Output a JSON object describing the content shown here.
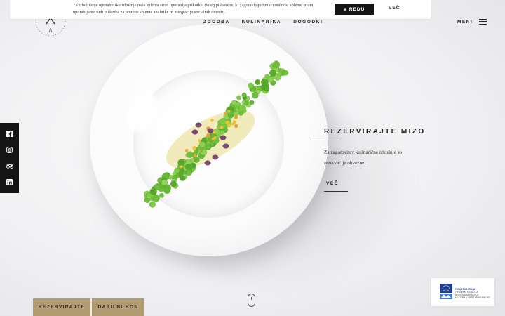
{
  "cookie": {
    "text": "Za izboljšanje uporabniške izkušnje naša spletna stran uporablja piškotke. Poleg piškotkov, ki zagotavljajo funkcionalnost spletne strani, uporabljamo tudi piškotke za potrebe spletne analitike in integracijo socialnih omrežij.",
    "accept_label": "V REDU",
    "more_label": "VEČ"
  },
  "logo": {
    "name": "logo-icon"
  },
  "nav": {
    "items": [
      {
        "label": "ZGODBA"
      },
      {
        "label": "KULINARIKA"
      },
      {
        "label": "DOGODKI"
      }
    ],
    "menu_label": "MENI"
  },
  "social": {
    "icons": [
      "facebook-icon",
      "instagram-icon",
      "tripadvisor-icon",
      "linkedin-icon"
    ]
  },
  "reservation": {
    "title": "REZERVIRAJTE MIZO",
    "text": "Za zagotovitev kulinarične izkušnje so rezervacije obvezne.",
    "more_label": "VEČ"
  },
  "bottom": {
    "reserve_label": "REZERVIRAJTE",
    "voucher_label": "DARILNI BON"
  },
  "eu_badge": {
    "title": "EVROPSKA UNIJA",
    "line1": "EVROPSKI SKLAD ZA",
    "line2": "REGIONALNI RAZVOJ",
    "line3": "NALOŽBA V VAŠO PRIHODNOST"
  },
  "colors": {
    "accent": "#b39b72",
    "dark": "#141414",
    "background": "#eeeef0"
  }
}
